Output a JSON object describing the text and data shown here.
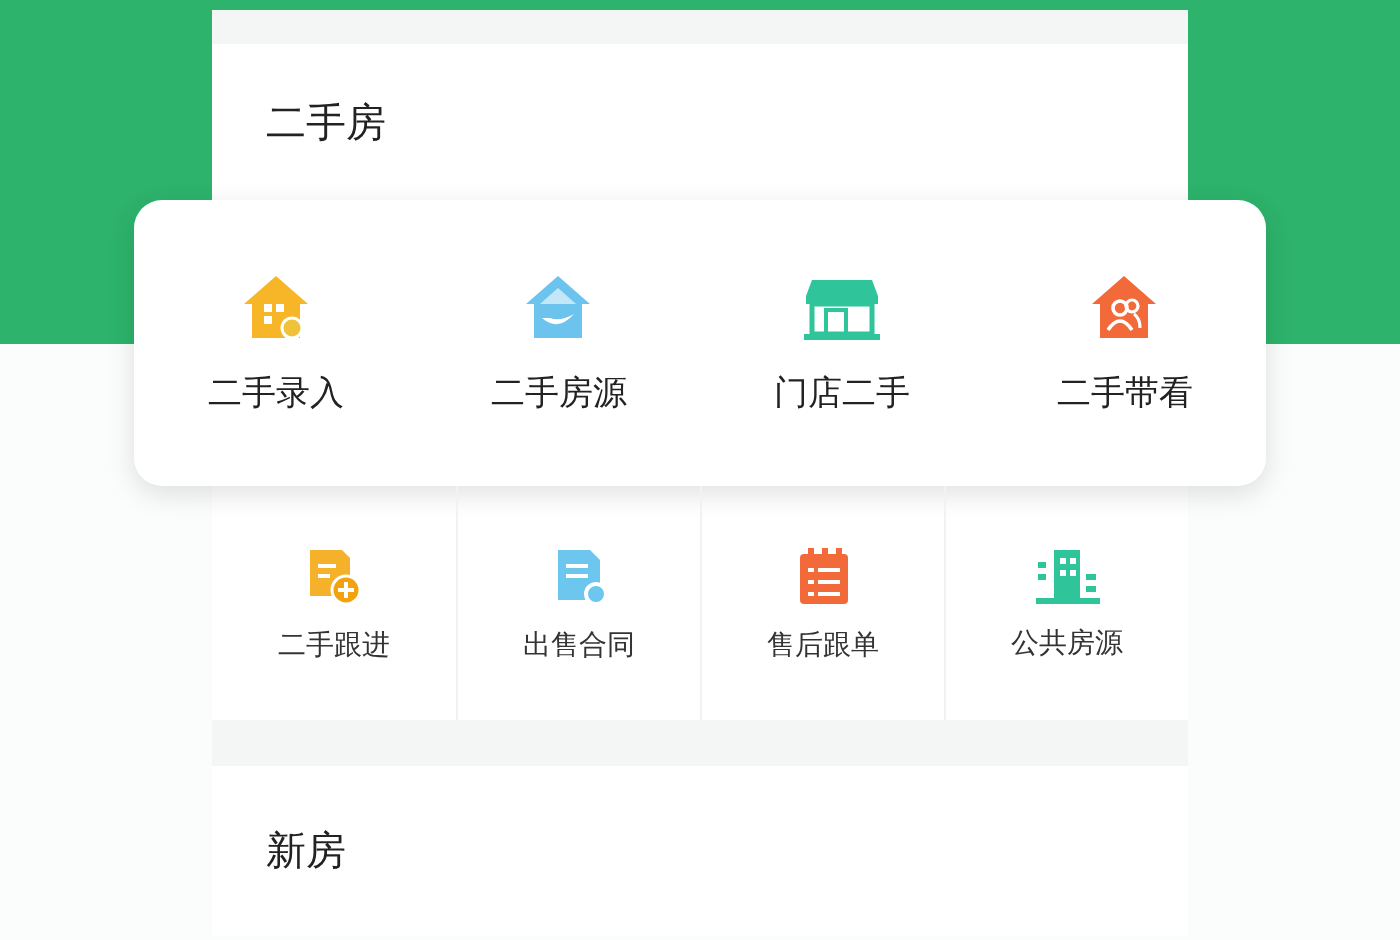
{
  "sections": [
    {
      "title": "二手房"
    }
  ],
  "featured": [
    {
      "label": "二手录入",
      "kind": "house-grid"
    },
    {
      "label": "二手房源",
      "kind": "house-hand"
    },
    {
      "label": "门店二手",
      "kind": "shop"
    },
    {
      "label": "二手带看",
      "kind": "house-people"
    }
  ],
  "tools": [
    {
      "label": "二手跟进",
      "kind": "doc-plus"
    },
    {
      "label": "出售合同",
      "kind": "doc-gear"
    },
    {
      "label": "售后跟单",
      "kind": "notepad"
    },
    {
      "label": "公共房源",
      "kind": "building"
    }
  ],
  "next_section": {
    "title": "新房"
  }
}
